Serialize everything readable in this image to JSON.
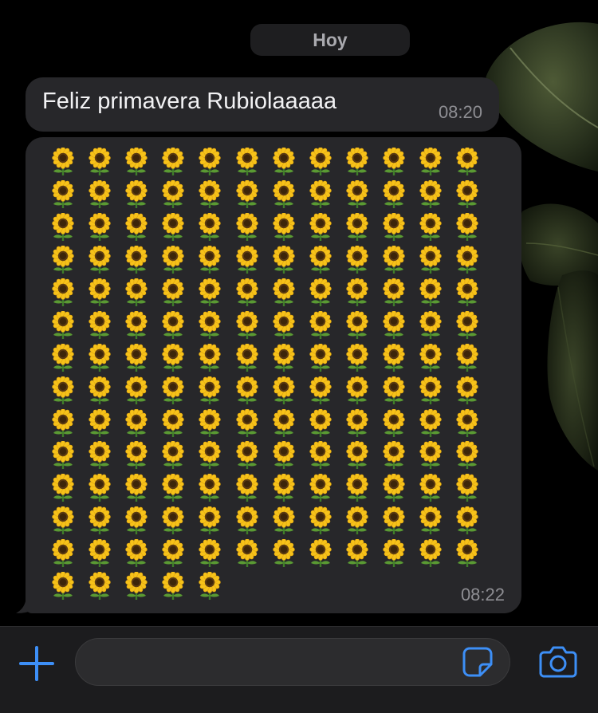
{
  "chat": {
    "date_separator": "Hoy",
    "messages": [
      {
        "text": "Feliz primavera Rubiolaaaaa",
        "time": "08:20"
      },
      {
        "emoji": "🌻",
        "emoji_name": "sunflower",
        "emoji_count": 161,
        "emoji_columns": 12,
        "time": "08:22"
      }
    ]
  },
  "input_bar": {
    "placeholder": "",
    "value": "",
    "icons": {
      "attach": "plus-icon",
      "sticker": "sticker-icon",
      "camera": "camera-icon"
    }
  },
  "colors": {
    "background": "#000000",
    "bubble": "#27272a",
    "accent": "#3d8ff7",
    "time_text": "#8e8e93"
  }
}
